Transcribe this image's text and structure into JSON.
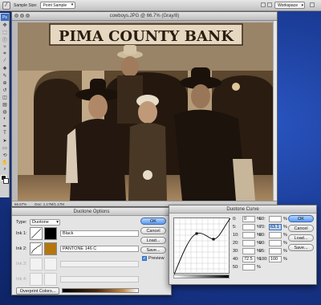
{
  "options_bar": {
    "sample_size_label": "Sample Size:",
    "sample_size_value": "Point Sample",
    "workspace_label": "Workspace"
  },
  "tools": {
    "top_label": "Ps",
    "icons": [
      "move-tool-icon",
      "marquee-tool-icon",
      "lasso-tool-icon",
      "quick-select-tool-icon",
      "crop-tool-icon",
      "eyedropper-tool-icon",
      "healing-tool-icon",
      "brush-tool-icon",
      "stamp-tool-icon",
      "history-brush-tool-icon",
      "eraser-tool-icon",
      "gradient-tool-icon",
      "blur-tool-icon",
      "dodge-tool-icon",
      "pen-tool-icon",
      "type-tool-icon",
      "path-select-tool-icon",
      "shape-tool-icon",
      "3d-rotate-tool-icon",
      "hand-tool-icon",
      "zoom-tool-icon"
    ],
    "glyphs": [
      "✥",
      "⬚",
      "ⓛ",
      "✧",
      "⌗",
      "⁄",
      "✚",
      "✎",
      "⊕",
      "↺",
      "◫",
      "▤",
      "◍",
      "◐",
      "✒",
      "T",
      "➤",
      "▭",
      "⟲",
      "✋",
      "⌕"
    ]
  },
  "document": {
    "title": "cowboys.JPG @ 66.7% (Gray/8)",
    "sign_text": "PIMA COUNTY BANK",
    "zoom": "66.67%",
    "doc_size": "Doc: 1.17M/1.17M"
  },
  "duotone_options": {
    "title": "Duotone Options",
    "type_label": "Type:",
    "type_value": "Duotone",
    "inks": [
      {
        "label": "Ink 1:",
        "name": "Black",
        "color": "#000000",
        "enabled": true
      },
      {
        "label": "Ink 2:",
        "name": "PANTONE 146 C",
        "color": "#B5760E",
        "enabled": true
      },
      {
        "label": "Ink 3:",
        "name": "",
        "color": "",
        "enabled": false
      },
      {
        "label": "Ink 4:",
        "name": "",
        "color": "",
        "enabled": false
      }
    ],
    "ok_label": "OK",
    "cancel_label": "Cancel",
    "load_label": "Load...",
    "save_label": "Save...",
    "preview_label": "Preview",
    "preview_checked": true,
    "overprint_label": "Overprint Colors..."
  },
  "duotone_curve": {
    "title": "Duotone Curve",
    "left_rows": [
      {
        "label": "0:",
        "value": "0",
        "pct": "%"
      },
      {
        "label": "5:",
        "value": "",
        "pct": "%"
      },
      {
        "label": "10:",
        "value": "",
        "pct": "%"
      },
      {
        "label": "20:",
        "value": "",
        "pct": "%"
      },
      {
        "label": "30:",
        "value": "",
        "pct": "%"
      },
      {
        "label": "40:",
        "value": "72.5",
        "pct": "%"
      },
      {
        "label": "50:",
        "value": "",
        "pct": "%"
      }
    ],
    "right_rows": [
      {
        "label": "60:",
        "value": "",
        "pct": "%"
      },
      {
        "label": "70:",
        "value": "63.1",
        "pct": "%",
        "selected": true
      },
      {
        "label": "80:",
        "value": "",
        "pct": "%"
      },
      {
        "label": "90:",
        "value": "",
        "pct": "%"
      },
      {
        "label": "95:",
        "value": "",
        "pct": "%"
      },
      {
        "label": "100:",
        "value": "100",
        "pct": "%"
      }
    ],
    "ok_label": "OK",
    "cancel_label": "Cancel",
    "load_label": "Load...",
    "save_label": "Save..."
  }
}
